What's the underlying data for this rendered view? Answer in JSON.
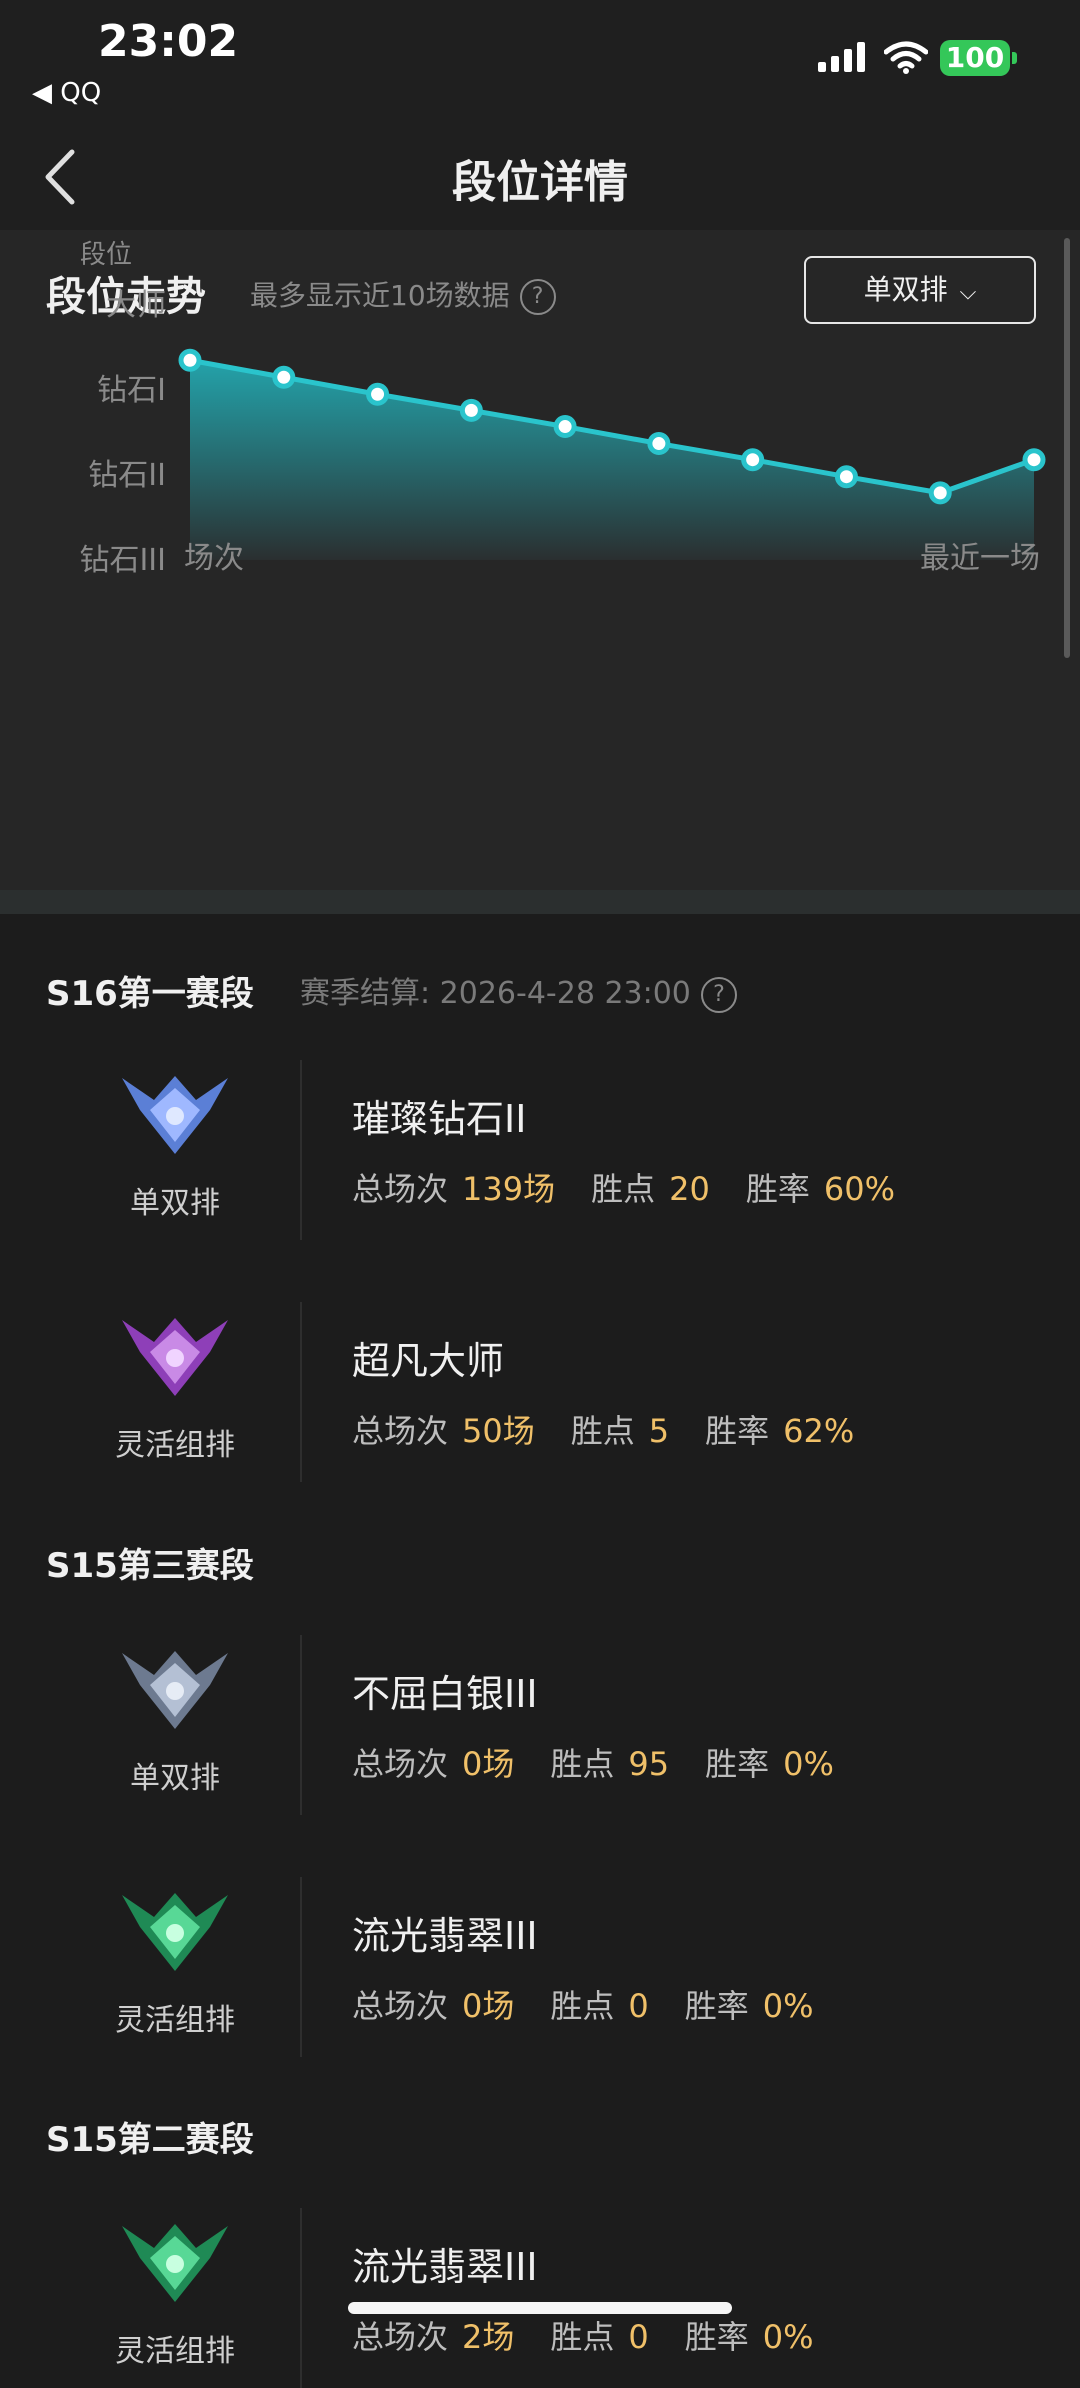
{
  "status_bar": {
    "time": "23:02",
    "back_app": "◀ QQ",
    "battery": "100"
  },
  "nav": {
    "title": "段位详情"
  },
  "trend": {
    "title": "段位走势",
    "subtitle": "最多显示近10场数据",
    "queue_selector": "单双排",
    "help": "?"
  },
  "chart_data": {
    "type": "area",
    "ylabel": "段位",
    "y_ticks": [
      "大师",
      "钻石I",
      "钻石II",
      "钻石III"
    ],
    "x_label_start": "场次",
    "x_label_end": "最近一场",
    "note": "values on rank scale where 0=钻石III, 1=钻石II, 2=钻石I, 3=大师",
    "values": [
      2.35,
      2.15,
      1.95,
      1.76,
      1.57,
      1.37,
      1.18,
      0.98,
      0.79,
      1.18
    ]
  },
  "colors": {
    "accent": "#2ac4cc",
    "gold": "#f0c069",
    "bg": "#1c1c1c",
    "card": "#262626"
  },
  "seasons": [
    {
      "name": "S16第一赛段",
      "note": "赛季结算: 2026-4-28 23:00",
      "ranks": [
        {
          "queue": "单双排",
          "rank": "璀璨钻石II",
          "total_label": "总场次",
          "total": "139场",
          "points_label": "胜点",
          "points": "20",
          "rate_label": "胜率",
          "rate": "60%",
          "emblem": "diamond-emblem-icon"
        },
        {
          "queue": "灵活组排",
          "rank": "超凡大师",
          "total_label": "总场次",
          "total": "50场",
          "points_label": "胜点",
          "points": "5",
          "rate_label": "胜率",
          "rate": "62%",
          "emblem": "master-emblem-icon"
        }
      ]
    },
    {
      "name": "S15第三赛段",
      "ranks": [
        {
          "queue": "单双排",
          "rank": "不屈白银III",
          "total_label": "总场次",
          "total": "0场",
          "points_label": "胜点",
          "points": "95",
          "rate_label": "胜率",
          "rate": "0%",
          "emblem": "silver-emblem-icon"
        },
        {
          "queue": "灵活组排",
          "rank": "流光翡翠III",
          "total_label": "总场次",
          "total": "0场",
          "points_label": "胜点",
          "points": "0",
          "rate_label": "胜率",
          "rate": "0%",
          "emblem": "emerald-emblem-icon"
        }
      ]
    },
    {
      "name": "S15第二赛段",
      "ranks": [
        {
          "queue": "灵活组排",
          "rank": "流光翡翠III",
          "total_label": "总场次",
          "total": "2场",
          "points_label": "胜点",
          "points": "0",
          "rate_label": "胜率",
          "rate": "0%",
          "emblem": "emerald-emblem-icon"
        }
      ]
    }
  ]
}
